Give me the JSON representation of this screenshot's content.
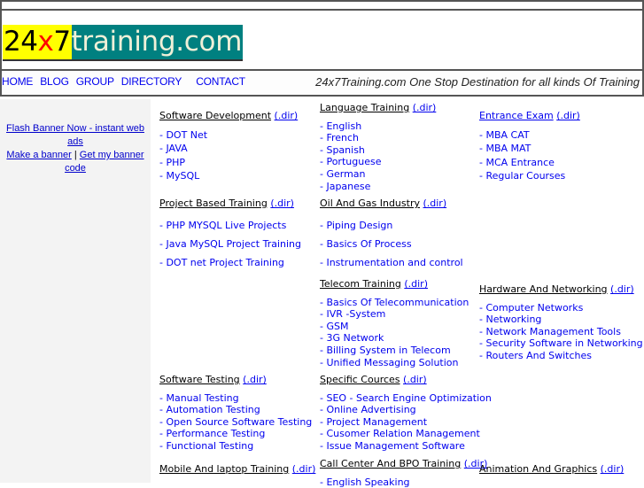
{
  "logo": {
    "part1a": "24",
    "part1x": "x",
    "part1b": "7",
    "part2": "training.com"
  },
  "nav": [
    {
      "label": "HOME"
    },
    {
      "label": "BLOG"
    },
    {
      "label": "GROUP"
    },
    {
      "label": "DIRECTORY"
    },
    {
      "label": "CONTACT"
    }
  ],
  "tagline": "24x7Training.com One Stop Destination for all kinds Of Training",
  "sidebar": {
    "ad_link1": "Flash Banner Now - instant web ads",
    "ad_link2": "Make a banner",
    "separator": "|",
    "ad_link3": "Get my banner code"
  },
  "categories": {
    "software_development": {
      "title": "Software Development",
      "dir": "(.dir)",
      "items": [
        "- DOT Net",
        "- JAVA",
        "- PHP",
        "- MySQL"
      ]
    },
    "language_training": {
      "title": "Language Training",
      "dir": "(.dir)",
      "items": [
        "- English",
        "- French",
        "- Spanish",
        "- Portuguese",
        "- German",
        "- Japanese"
      ]
    },
    "entrance_exam": {
      "title": "Entrance Exam",
      "dir": "(.dir)",
      "items": [
        "- MBA CAT",
        "- MBA MAT",
        "- MCA Entrance",
        "- Regular Courses"
      ]
    },
    "project_based": {
      "title": "Project Based Training",
      "dir": "(.dir)",
      "items": [
        "- PHP MYSQL Live Projects",
        "- Java MySQL Project Training",
        "- DOT net Project Training"
      ]
    },
    "oil_gas": {
      "title": "Oil And Gas Industry",
      "dir": "(.dir)",
      "items": [
        "- Piping Design",
        "- Basics Of Process",
        "- Instrumentation and control"
      ]
    },
    "telecom": {
      "title": "Telecom Training",
      "dir": "(.dir)",
      "items": [
        "- Basics Of Telecommunication",
        "- IVR -System",
        "- GSM",
        "- 3G Network",
        "- Billing System in Telecom",
        "- Unified Messaging Solution"
      ]
    },
    "hardware_networking": {
      "title": "Hardware And Networking",
      "dir": "(.dir)",
      "items": [
        "- Computer Networks",
        "- Networking",
        "- Network Management Tools",
        "- Security Software in Networking",
        "- Routers And Switches"
      ]
    },
    "software_testing": {
      "title": "Software Testing",
      "dir": "(.dir)",
      "items": [
        "- Manual Testing",
        "- Automation Testing",
        "- Open Source Software Testing",
        "- Performance Testing",
        "- Functional Testing"
      ]
    },
    "specific_cources": {
      "title": "Specific Cources",
      "dir": "(.dir)",
      "items": [
        "- SEO - Search Engine Optimization",
        "- Online Advertising",
        "- Project Management",
        "- Cusomer Relation Management",
        "- Issue Management Software"
      ]
    },
    "mobile_laptop": {
      "title": "Mobile And laptop Training",
      "dir": "(.dir)",
      "items": []
    },
    "call_center": {
      "title": "Call Center And BPO Training",
      "dir": "(.dir)",
      "items": [
        "- English Speaking"
      ]
    },
    "animation": {
      "title": "Animation And Graphics",
      "dir": "(.dir)",
      "items": []
    }
  }
}
